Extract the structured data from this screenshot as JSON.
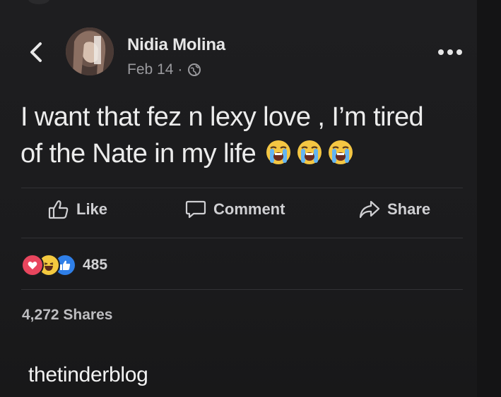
{
  "post": {
    "author": "Nidia Molina",
    "date": "Feb 14",
    "separator": "·",
    "visibility_icon": "globe-icon",
    "text_line_1": "I want that fez n lexy love , I’m tired",
    "text_line_2": "of the Nate in my life",
    "emojis": [
      "loudly-crying-face",
      "loudly-crying-face",
      "loudly-crying-face"
    ]
  },
  "actions": {
    "like": "Like",
    "comment": "Comment",
    "share": "Share"
  },
  "stats": {
    "reaction_icons": [
      "love",
      "haha",
      "like"
    ],
    "reaction_count": "485",
    "shares": "4,272 Shares"
  },
  "watermark": "thetinderblog",
  "colors": {
    "background": "#1b1b1d",
    "text": "#ececec",
    "muted": "#9a9a9e",
    "love": "#e8465e",
    "haha": "#f3c93f",
    "like": "#2f7fe8"
  }
}
